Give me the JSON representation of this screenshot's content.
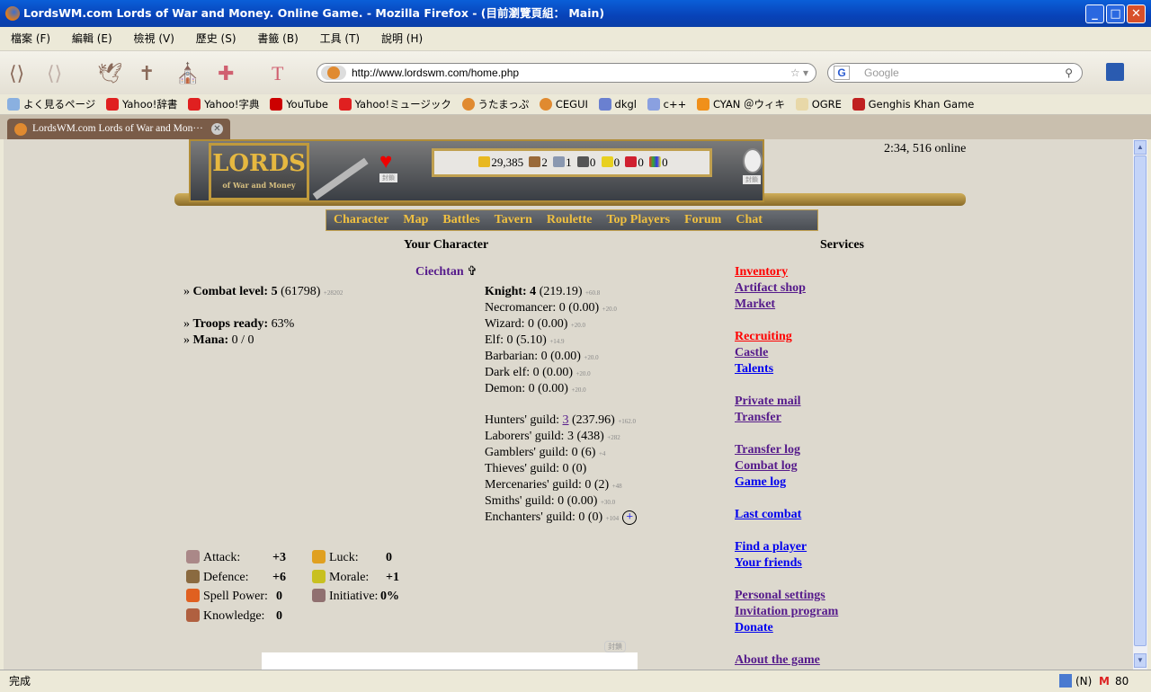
{
  "window": {
    "title": "LordsWM.com Lords of War and Money. Online Game. - Mozilla Firefox - (目前瀏覽頁組： Main)"
  },
  "menu": [
    "檔案 (F)",
    "編輯 (E)",
    "檢視 (V)",
    "歷史 (S)",
    "書籤 (B)",
    "工具 (T)",
    "說明 (H)"
  ],
  "toolbar": {
    "url": "http://www.lordswm.com/home.php",
    "search_placeholder": "Google"
  },
  "bookmarks": [
    "よく見るページ",
    "Yahoo!辞書",
    "Yahoo!字典",
    "YouTube",
    "Yahoo!ミュージック",
    "うたまっぷ",
    "CEGUI",
    "dkgl",
    "c++",
    "CYAN ＠ウィキ",
    "OGRE",
    "Genghis Khan Game"
  ],
  "tab": {
    "title": "LordsWM.com Lords of War and Mon···"
  },
  "status": {
    "text": "完成",
    "n_label": "(N)",
    "mail_count": "80"
  },
  "game": {
    "logo": {
      "title": "LORDS",
      "subtitle": "of War and Money"
    },
    "online": "2:34, 516 online",
    "resources": [
      "29,385",
      "2",
      "1",
      "0",
      "0",
      "0",
      "0"
    ],
    "nav": [
      "Character",
      "Map",
      "Battles",
      "Tavern",
      "Roulette",
      "Top Players",
      "Forum",
      "Chat"
    ],
    "your_character": "Your Character",
    "services_title": "Services",
    "player_name": "Ciechtan",
    "combat_level": {
      "label": "Combat level:",
      "level": "5",
      "exp": "(61798)",
      "next": "+28202"
    },
    "troops": {
      "label": "Troops ready:",
      "value": "63%"
    },
    "mana": {
      "label": "Mana:",
      "value": "0 / 0"
    },
    "factions": [
      {
        "label": "Knight: 4",
        "value": "(219.19)",
        "next": "+60.8"
      },
      {
        "label": "Necromancer: 0",
        "value": "(0.00)",
        "next": "+20.0"
      },
      {
        "label": "Wizard: 0",
        "value": "(0.00)",
        "next": "+20.0"
      },
      {
        "label": "Elf: 0",
        "value": "(5.10)",
        "next": "+14.9"
      },
      {
        "label": "Barbarian: 0",
        "value": "(0.00)",
        "next": "+20.0"
      },
      {
        "label": "Dark elf: 0",
        "value": "(0.00)",
        "next": "+20.0"
      },
      {
        "label": "Demon: 0",
        "value": "(0.00)",
        "next": "+20.0"
      }
    ],
    "guilds": [
      {
        "label": "Hunters' guild: ",
        "level": "3",
        "value": " (237.96)",
        "next": "+162.0"
      },
      {
        "label": "Laborers' guild: 3",
        "value": " (438)",
        "next": "+282"
      },
      {
        "label": "Gamblers' guild: 0",
        "value": " (6)",
        "next": "+4"
      },
      {
        "label": "Thieves' guild: 0",
        "value": " (0)",
        "next": ""
      },
      {
        "label": "Mercenaries' guild: 0",
        "value": " (2)",
        "next": "+48"
      },
      {
        "label": "Smiths' guild: 0",
        "value": " (0.00)",
        "next": "+30.0"
      },
      {
        "label": "Enchanters' guild: 0",
        "value": " (0)",
        "next": "+104"
      }
    ],
    "plus": "+",
    "stats": [
      {
        "label": "Attack:",
        "value": "+3"
      },
      {
        "label": "Defence:",
        "value": "+6"
      },
      {
        "label": "Spell Power:",
        "value": "0"
      },
      {
        "label": "Knowledge:",
        "value": "0"
      },
      {
        "label": "Luck:",
        "value": "0"
      },
      {
        "label": "Morale:",
        "value": "+1"
      },
      {
        "label": "Initiative:",
        "value": "0%"
      }
    ],
    "services": [
      {
        "label": "Inventory",
        "color": "#ff0000"
      },
      {
        "label": "Artifact shop",
        "color": "#551a8b"
      },
      {
        "label": "Market",
        "color": "#551a8b"
      },
      {
        "label": "Recruiting",
        "color": "#ff0000"
      },
      {
        "label": "Castle",
        "color": "#551a8b"
      },
      {
        "label": "Talents",
        "color": "#0000ee"
      },
      {
        "label": "Private mail",
        "color": "#551a8b"
      },
      {
        "label": "Transfer",
        "color": "#551a8b"
      },
      {
        "label": "Transfer log",
        "color": "#551a8b"
      },
      {
        "label": "Combat log",
        "color": "#551a8b"
      },
      {
        "label": "Game log",
        "color": "#0000ee"
      },
      {
        "label": "Last combat",
        "color": "#0000ee"
      },
      {
        "label": "Find a player",
        "color": "#0000ee"
      },
      {
        "label": "Your friends",
        "color": "#0000ee"
      },
      {
        "label": "Personal settings",
        "color": "#551a8b"
      },
      {
        "label": "Invitation program",
        "color": "#551a8b"
      },
      {
        "label": "Donate",
        "color": "#0000ee"
      },
      {
        "label": "About the game",
        "color": "#551a8b"
      }
    ],
    "block_label": "封鎖"
  }
}
